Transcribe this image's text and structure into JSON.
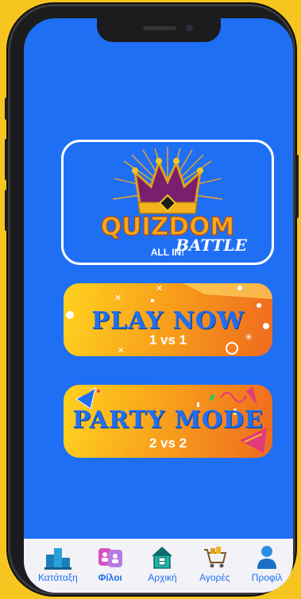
{
  "logo": {
    "word1": "QUIZDOM",
    "word2": "BATTLE",
    "tagline": "ALL IN!"
  },
  "modes": [
    {
      "title": "PLAY NOW",
      "subtitle": "1 vs 1"
    },
    {
      "title": "PARTY MODE",
      "subtitle": "2 vs 2"
    }
  ],
  "tabs": [
    {
      "label": "Κατάταξη",
      "icon": "podium-icon"
    },
    {
      "label": "Φίλοι",
      "icon": "friends-icon"
    },
    {
      "label": "Αρχική",
      "icon": "home-icon"
    },
    {
      "label": "Αγορές",
      "icon": "shop-icon"
    },
    {
      "label": "Προφίλ",
      "icon": "profile-icon"
    }
  ],
  "colors": {
    "background": "#f7c520",
    "screen": "#1f6ff4",
    "accent": "#1f6ff4",
    "button_gradient_start": "#ffd21f",
    "button_gradient_end": "#ef6a1f"
  }
}
